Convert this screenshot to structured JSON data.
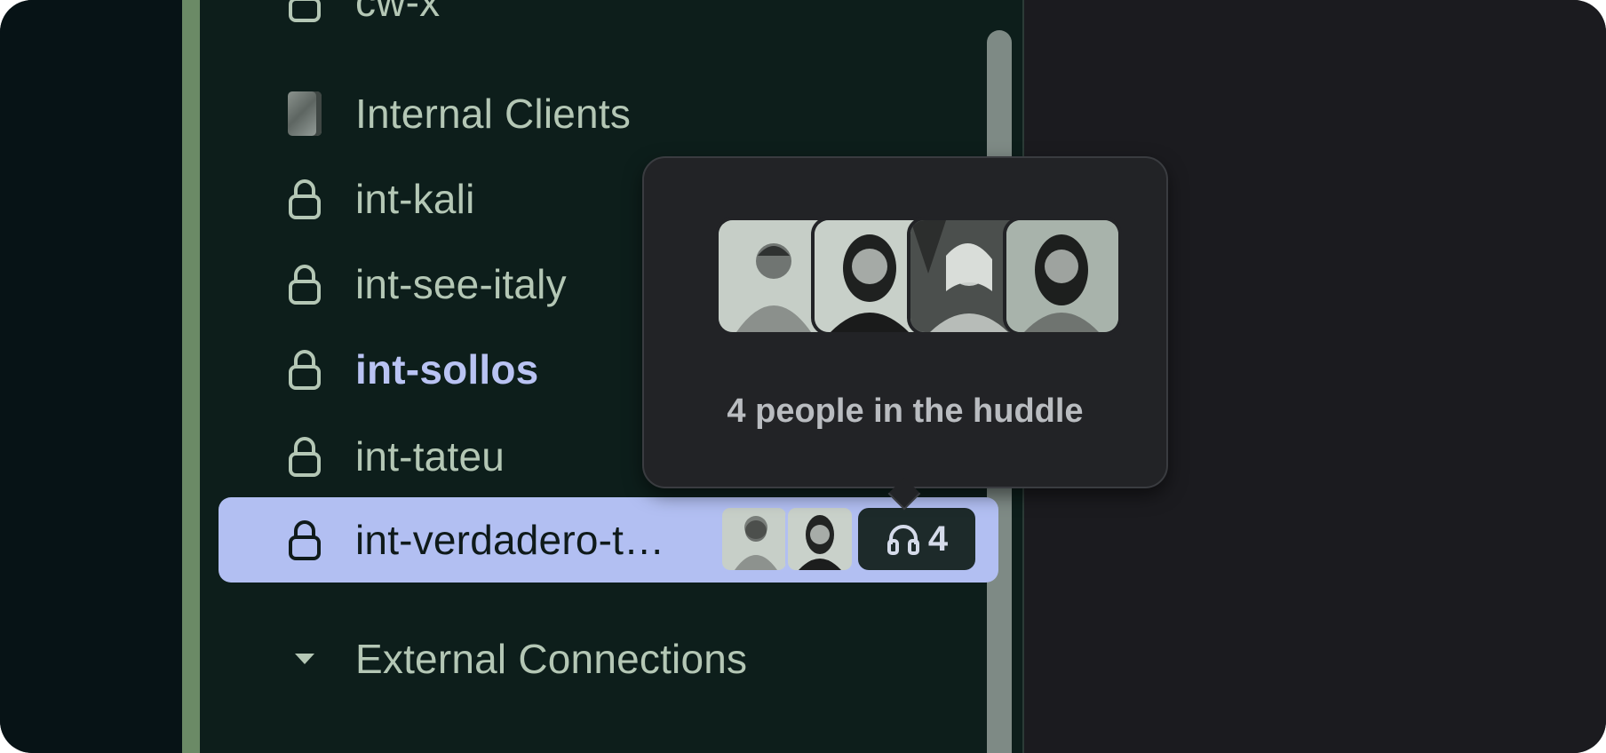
{
  "sidebar": {
    "cut_item": {
      "label": "cw-x",
      "icon": "lock-icon"
    },
    "internal_clients": {
      "label": "Internal Clients",
      "icon": "book-icon"
    },
    "channels": [
      {
        "label": "int-kali",
        "icon": "lock-icon",
        "bold": false,
        "active": false
      },
      {
        "label": "int-see-italy",
        "icon": "lock-icon",
        "bold": false,
        "active": false
      },
      {
        "label": "int-sollos",
        "icon": "lock-icon",
        "bold": true,
        "active": false
      },
      {
        "label": "int-tateu",
        "icon": "lock-icon",
        "bold": false,
        "active": false
      },
      {
        "label": "int-verdadero-t…",
        "icon": "lock-icon",
        "bold": false,
        "active": true
      }
    ],
    "section": {
      "label": "External Connections",
      "icon": "caret-down-icon"
    }
  },
  "huddle": {
    "count": "4",
    "icon": "headphones-icon",
    "tooltip_text": "4 people in the huddle"
  },
  "colors": {
    "sidebar_bg": "#0d1e1b",
    "rail": "#6b8a66",
    "active_row": "#b2bff2",
    "text": "#b4c7b5",
    "bold_text": "#b9c3f3",
    "tooltip_bg": "#222326"
  }
}
